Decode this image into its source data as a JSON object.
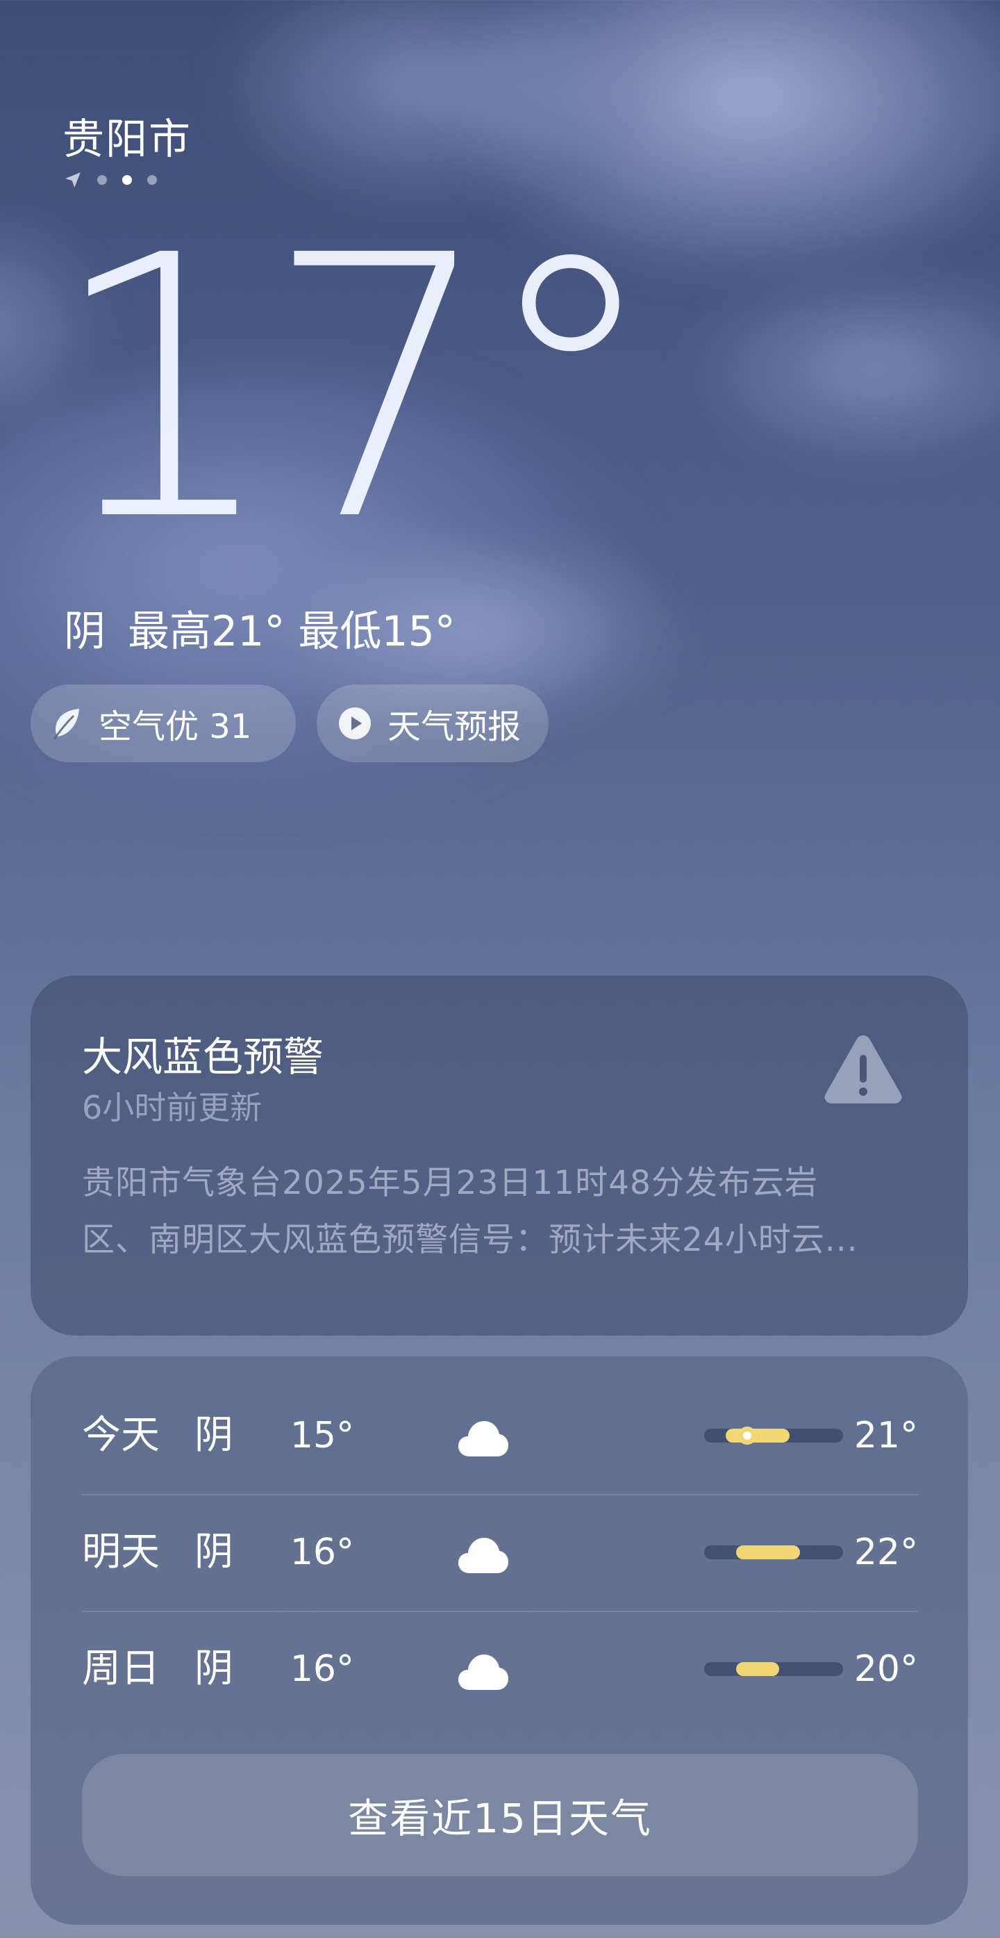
{
  "location": {
    "city": "贵阳市",
    "page_count": 4,
    "current_page": 3
  },
  "current": {
    "temperature": "17°",
    "condition": "阴",
    "high_low": "最高21° 最低15°"
  },
  "pills": {
    "aqi_label": "空气优 31",
    "forecast_label": "天气预报",
    "aqi_icon": "leaf-icon",
    "forecast_icon": "play-icon"
  },
  "alert": {
    "title": "大风蓝色预警",
    "updated": "6小时前更新",
    "body_line1": "贵阳市气象台2025年5月23日11时48分发布云岩",
    "body_line2": "区、南明区大风蓝色预警信号：预计未来24小时云...",
    "icon": "warning-icon"
  },
  "forecast": {
    "days": [
      {
        "day": "今天",
        "condition": "阴",
        "icon": "cloud-icon",
        "low": "15°",
        "high": "21°",
        "low_value": 15,
        "high_value": 21,
        "now_value": 17
      },
      {
        "day": "明天",
        "condition": "阴",
        "icon": "cloud-icon",
        "low": "16°",
        "high": "22°",
        "low_value": 16,
        "high_value": 22
      },
      {
        "day": "周日",
        "condition": "阴",
        "icon": "cloud-icon",
        "low": "16°",
        "high": "20°",
        "low_value": 16,
        "high_value": 20
      }
    ],
    "range_min": 13,
    "range_max": 26,
    "more_button": "查看近15日天气"
  },
  "colors": {
    "bar_fill": "#f0d774",
    "background_top": "#3f4e76",
    "background_bottom": "#8792ad"
  }
}
